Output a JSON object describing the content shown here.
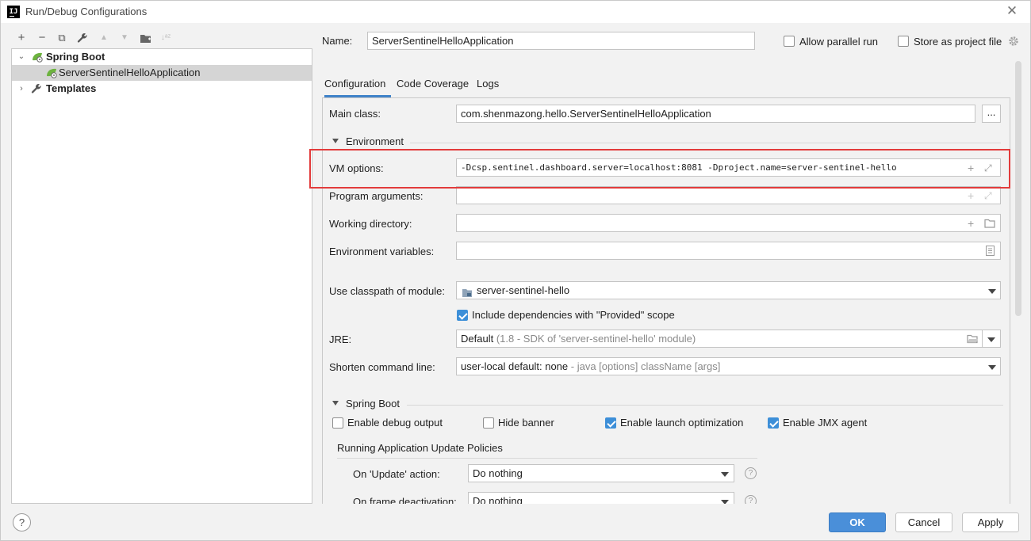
{
  "window": {
    "app_icon": "IJ",
    "title": "Run/Debug Configurations",
    "close_icon": "✕"
  },
  "toolbar": {
    "add": "+",
    "remove": "−",
    "copy": "⧉",
    "edit_defaults": "🔧",
    "move_up": "▲",
    "move_down": "▼",
    "new_folder": "▣",
    "sort": "↓ᵃᶻ"
  },
  "tree": {
    "spring_boot": "Spring Boot",
    "config_item": "ServerSentinelHelloApplication",
    "templates": "Templates"
  },
  "name_row": {
    "label": "Name:",
    "value": "ServerSentinelHelloApplication",
    "allow_parallel": "Allow parallel run",
    "store_as_project": "Store as project file"
  },
  "tabs": [
    "Configuration",
    "Code Coverage",
    "Logs"
  ],
  "config": {
    "main_class_label": "Main class:",
    "main_class_value": "com.shenmazong.hello.ServerSentinelHelloApplication",
    "browse_button": "...",
    "environment_section": "Environment",
    "vm_options_label": "VM options:",
    "vm_options_value": "-Dcsp.sentinel.dashboard.server=localhost:8081 -Dproject.name=server-sentinel-hello",
    "program_args_label": "Program arguments:",
    "working_dir_label": "Working directory:",
    "env_vars_label": "Environment variables:",
    "classpath_label": "Use classpath of module:",
    "classpath_value": "server-sentinel-hello",
    "include_deps_label": "Include dependencies with \"Provided\" scope",
    "jre_label": "JRE:",
    "jre_value": "Default",
    "jre_hint": "(1.8 - SDK of 'server-sentinel-hello' module)",
    "shorten_label": "Shorten command line:",
    "shorten_value": "user-local default: none",
    "shorten_hint": "- java [options] className [args]",
    "spring_boot_section": "Spring Boot",
    "enable_debug_output": "Enable debug output",
    "hide_banner": "Hide banner",
    "enable_launch_opt": "Enable launch optimization",
    "enable_jmx": "Enable JMX agent",
    "policies_title": "Running Application Update Policies",
    "on_update_label": "On 'Update' action:",
    "on_update_value": "Do nothing",
    "on_frame_label": "On frame deactivation:",
    "on_frame_value": "Do nothing"
  },
  "footer": {
    "help": "?",
    "ok": "OK",
    "cancel": "Cancel",
    "apply": "Apply"
  },
  "colors": {
    "accent": "#4a8fd9",
    "highlight_box": "#e23b3b",
    "tree_selection": "#d5d5d5"
  }
}
